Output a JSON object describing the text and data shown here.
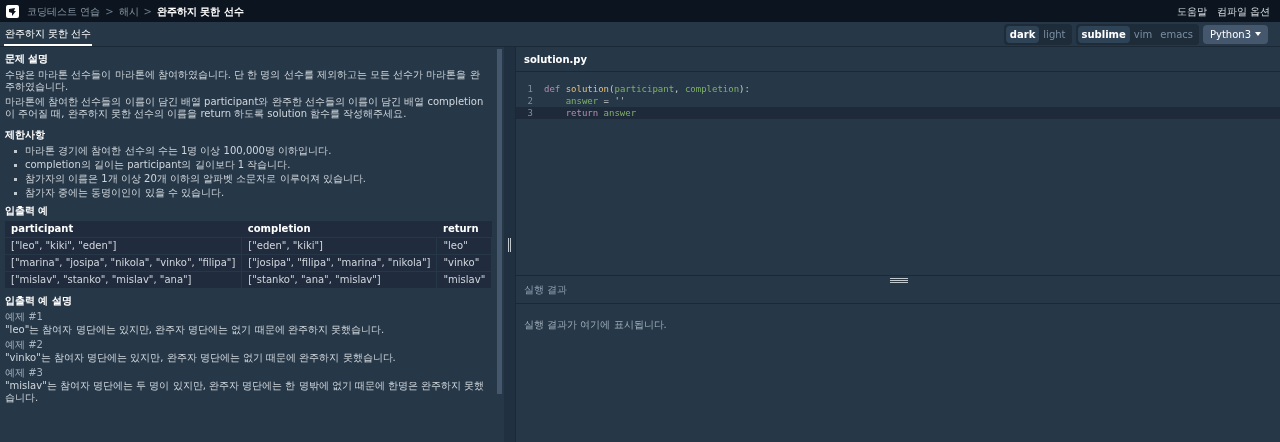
{
  "breadcrumbs": [
    {
      "label": "코딩테스트 연습",
      "current": false
    },
    {
      "label": "해시",
      "current": false
    },
    {
      "label": "완주하지 못한 선수",
      "current": true
    }
  ],
  "breadcrumb_separator": ">",
  "top_links": [
    "도움말",
    "컴파일 옵션"
  ],
  "tab": {
    "label": "완주하지 못한 선수",
    "selected": true
  },
  "theme_toggle": [
    {
      "label": "dark",
      "selected": true
    },
    {
      "label": "light",
      "selected": false
    }
  ],
  "keymap_toggle": [
    {
      "label": "sublime",
      "selected": true
    },
    {
      "label": "vim",
      "selected": false
    },
    {
      "label": "emacs",
      "selected": false
    }
  ],
  "language_select": {
    "value": "Python3"
  },
  "problem": {
    "description_heading": "문제 설명",
    "paragraphs": [
      "수많은 마라톤 선수들이 마라톤에 참여하였습니다. 단 한 명의 선수를 제외하고는 모든 선수가 마라톤을 완주하였습니다.",
      "마라톤에 참여한 선수들의 이름이 담긴 배열 participant와 완주한 선수들의 이름이 담긴 배열 completion이 주어질 때, 완주하지 못한 선수의 이름을 return 하도록 solution 함수를 작성해주세요."
    ],
    "constraints_heading": "제한사항",
    "constraints": [
      "마라톤 경기에 참여한 선수의 수는 1명 이상 100,000명 이하입니다.",
      "completion의 길이는 participant의 길이보다 1 작습니다.",
      "참가자의 이름은 1개 이상 20개 이하의 알파벳 소문자로 이루어져 있습니다.",
      "참가자 중에는 동명이인이 있을 수 있습니다."
    ],
    "examples_heading": "입출력 예",
    "table": {
      "columns": [
        "participant",
        "completion",
        "return"
      ],
      "rows": [
        [
          "[\"leo\", \"kiki\", \"eden\"]",
          "[\"eden\", \"kiki\"]",
          "\"leo\""
        ],
        [
          "[\"marina\", \"josipa\", \"nikola\", \"vinko\", \"filipa\"]",
          "[\"josipa\", \"filipa\", \"marina\", \"nikola\"]",
          "\"vinko\""
        ],
        [
          "[\"mislav\", \"stanko\", \"mislav\", \"ana\"]",
          "[\"stanko\", \"ana\", \"mislav\"]",
          "\"mislav\""
        ]
      ]
    },
    "explanation_heading": "입출력 예 설명",
    "explanations": [
      {
        "title": "예제 #1",
        "text": "\"leo\"는 참여자 명단에는 있지만, 완주자 명단에는 없기 때문에 완주하지 못했습니다."
      },
      {
        "title": "예제 #2",
        "text": "\"vinko\"는 참여자 명단에는 있지만, 완주자 명단에는 없기 때문에 완주하지 못했습니다."
      },
      {
        "title": "예제 #3",
        "text": "\"mislav\"는 참여자 명단에는 두 명이 있지만, 완주자 명단에는 한 명밖에 없기 때문에 한명은 완주하지 못했습니다."
      }
    ]
  },
  "editor": {
    "filename": "solution.py",
    "lines": [
      {
        "number": "1",
        "active": false,
        "tokens": [
          {
            "kind": "keyword",
            "text": "def "
          },
          {
            "kind": "function",
            "text": "solution"
          },
          {
            "kind": "plain",
            "text": "("
          },
          {
            "kind": "variable",
            "text": "participant"
          },
          {
            "kind": "plain",
            "text": ", "
          },
          {
            "kind": "variable",
            "text": "completion"
          },
          {
            "kind": "plain",
            "text": "):"
          }
        ]
      },
      {
        "number": "2",
        "active": false,
        "tokens": [
          {
            "kind": "variable",
            "text": "    answer"
          },
          {
            "kind": "plain",
            "text": " = "
          },
          {
            "kind": "string",
            "text": "''"
          }
        ]
      },
      {
        "number": "3",
        "active": true,
        "tokens": [
          {
            "kind": "keyword",
            "text": "    return "
          },
          {
            "kind": "variable",
            "text": "answer"
          }
        ]
      }
    ]
  },
  "output": {
    "heading": "실행 결과",
    "message": "실행 결과가 여기에 표시됩니다."
  }
}
